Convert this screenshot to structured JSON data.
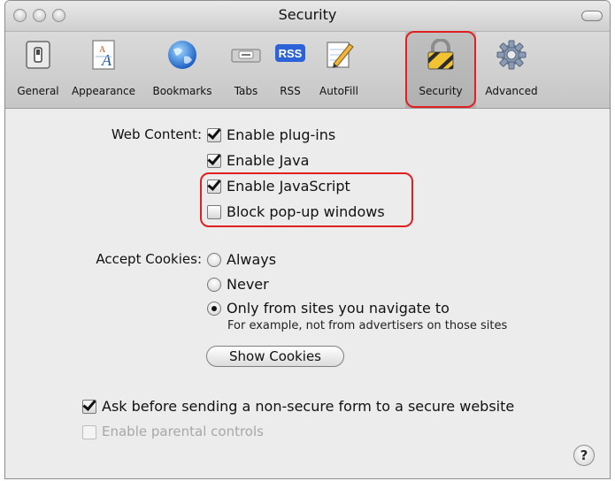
{
  "window": {
    "title": "Security"
  },
  "toolbar": {
    "items": [
      {
        "label": "General",
        "icon": "switch-icon"
      },
      {
        "label": "Appearance",
        "icon": "font-icon"
      },
      {
        "label": "Bookmarks",
        "icon": "globe-icon"
      },
      {
        "label": "Tabs",
        "icon": "tabs-icon"
      },
      {
        "label": "RSS",
        "icon": "rss-icon"
      },
      {
        "label": "AutoFill",
        "icon": "pencil-icon"
      },
      {
        "label": "Security",
        "icon": "lock-icon"
      },
      {
        "label": "Advanced",
        "icon": "gear-icon"
      }
    ],
    "rss_badge": "RSS"
  },
  "web_content": {
    "label": "Web Content:",
    "options": [
      {
        "label": "Enable plug-ins",
        "checked": true
      },
      {
        "label": "Enable Java",
        "checked": true
      },
      {
        "label": "Enable JavaScript",
        "checked": true
      },
      {
        "label": "Block pop-up windows",
        "checked": false
      }
    ]
  },
  "cookies": {
    "label": "Accept Cookies:",
    "options": [
      {
        "label": "Always",
        "selected": false
      },
      {
        "label": "Never",
        "selected": false
      },
      {
        "label": "Only from sites you navigate to",
        "selected": true
      }
    ],
    "note": "For example, not from advertisers on those sites",
    "show_cookies_button": "Show Cookies"
  },
  "bottom": {
    "ask_non_secure": {
      "label": "Ask before sending a non-secure form to a secure website",
      "checked": true
    },
    "parental": {
      "label": "Enable parental controls",
      "checked": false,
      "disabled": true
    }
  },
  "help": {
    "label": "?"
  },
  "colors": {
    "highlight": "#e02020",
    "window_bg": "#ececec"
  }
}
